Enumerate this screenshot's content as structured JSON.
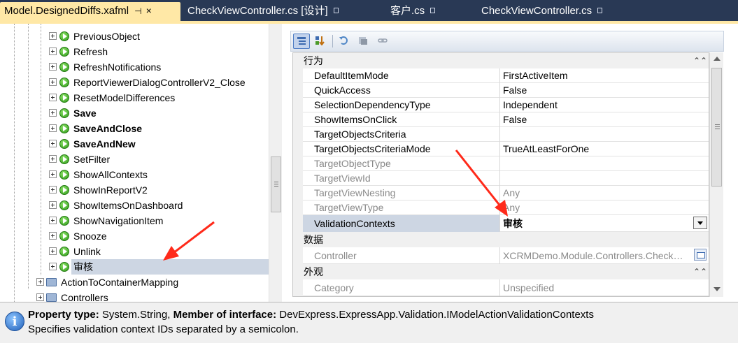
{
  "tabs": [
    {
      "label": "Model.DesignedDiffs.xafml",
      "active": true,
      "pin": "⊣",
      "close": "×"
    },
    {
      "label": "CheckViewController.cs [设计]",
      "active": false
    },
    {
      "label": "客户.cs",
      "active": false
    },
    {
      "label": "CheckViewController.cs",
      "active": false
    }
  ],
  "tree": {
    "items": [
      {
        "label": "PreviousObject",
        "bold": false
      },
      {
        "label": "Refresh",
        "bold": false
      },
      {
        "label": "RefreshNotifications",
        "bold": false
      },
      {
        "label": "ReportViewerDialogControllerV2_Close",
        "bold": false
      },
      {
        "label": "ResetModelDifferences",
        "bold": false
      },
      {
        "label": "Save",
        "bold": true
      },
      {
        "label": "SaveAndClose",
        "bold": true
      },
      {
        "label": "SaveAndNew",
        "bold": true
      },
      {
        "label": "SetFilter",
        "bold": false
      },
      {
        "label": "ShowAllContexts",
        "bold": false
      },
      {
        "label": "ShowInReportV2",
        "bold": false
      },
      {
        "label": "ShowItemsOnDashboard",
        "bold": false
      },
      {
        "label": "ShowNavigationItem",
        "bold": false
      },
      {
        "label": "Snooze",
        "bold": false
      },
      {
        "label": "Unlink",
        "bold": false
      },
      {
        "label": "审核",
        "bold": false,
        "selected": true
      }
    ],
    "parent_items": [
      {
        "label": "ActionToContainerMapping"
      },
      {
        "label": "Controllers"
      }
    ]
  },
  "property_grid": {
    "categories": [
      {
        "label": "行为",
        "rows": [
          {
            "name": "DefaultItemMode",
            "value": "FirstActiveItem",
            "readonly": false
          },
          {
            "name": "QuickAccess",
            "value": "False",
            "readonly": false
          },
          {
            "name": "SelectionDependencyType",
            "value": "Independent",
            "readonly": false
          },
          {
            "name": "ShowItemsOnClick",
            "value": "False",
            "readonly": false
          },
          {
            "name": "TargetObjectsCriteria",
            "value": "",
            "readonly": false
          },
          {
            "name": "TargetObjectsCriteriaMode",
            "value": "TrueAtLeastForOne",
            "readonly": false
          },
          {
            "name": "TargetObjectType",
            "value": "",
            "readonly": true
          },
          {
            "name": "TargetViewId",
            "value": "",
            "readonly": true
          },
          {
            "name": "TargetViewNesting",
            "value": "Any",
            "readonly": true
          },
          {
            "name": "TargetViewType",
            "value": "Any",
            "readonly": true
          },
          {
            "name": "ValidationContexts",
            "value": "审核",
            "readonly": false,
            "selected": true
          }
        ]
      },
      {
        "label": "数据",
        "rows": [
          {
            "name": "Controller",
            "value": "XCRMDemo.Module.Controllers.Check…",
            "readonly": true
          }
        ]
      },
      {
        "label": "外观",
        "rows": [
          {
            "name": "Category",
            "value": "Unspecified",
            "readonly": true
          }
        ]
      }
    ],
    "collapse_glyph": "⌃⌃"
  },
  "description": {
    "type_label": "Property type:",
    "type_value": "System.String,",
    "member_label": "Member of interface:",
    "member_value": "DevExpress.ExpressApp.Validation.IModelActionValidationContexts",
    "text": "Specifies validation context IDs separated by a semicolon.",
    "icon_glyph": "i"
  },
  "colors": {
    "tab_bar": "#293955",
    "active_tab": "#ffe8a6",
    "selection": "#cdd6e3",
    "arrow": "#ff2a1a"
  }
}
